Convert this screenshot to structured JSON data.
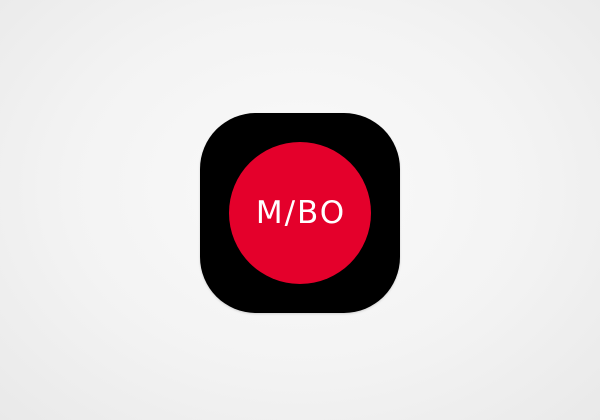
{
  "app_icon": {
    "logo_text": "M/BO",
    "icon_name": "mibo-app-icon",
    "colors": {
      "frame": "#000000",
      "circle": "#e4002b",
      "text": "#ffffff",
      "background": "#f3f3f3"
    }
  }
}
